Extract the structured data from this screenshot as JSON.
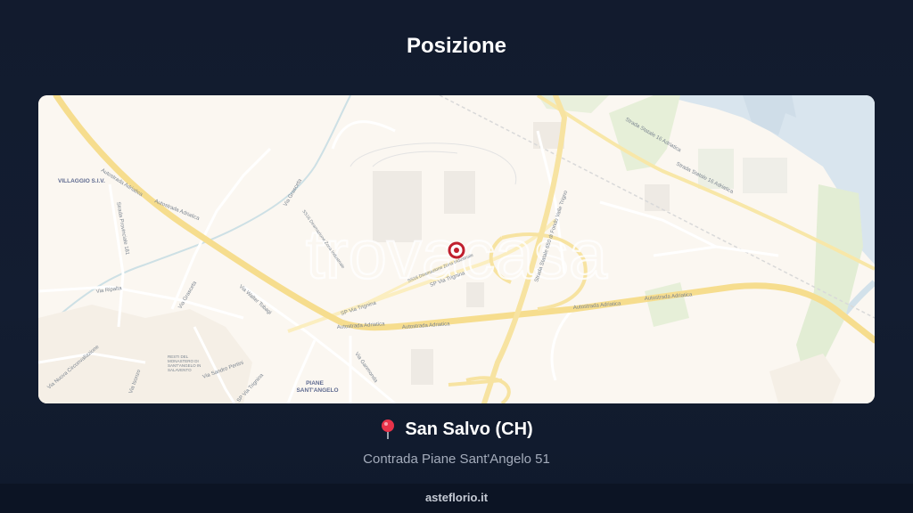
{
  "title": "Posizione",
  "map": {
    "watermark": "trovacasa",
    "place_labels": {
      "villaggio": "VILLAGGIO S.I.V.",
      "piane": "PIANE",
      "santangelo": "SANT'ANGELO",
      "resti_1": "RESTI DEL",
      "resti_2": "MONASTERO DI",
      "resti_3": "SANT'ANGELO IN",
      "resti_4": "SALAVENTO"
    },
    "road_labels": {
      "autostrada_1": "Autostrada Adriatica",
      "autostrada_2": "Autostrada Adriatica",
      "autostrada_3": "Autostrada Adriatica",
      "autostrada_4": "Autostrada Adriatica",
      "autostrada_5": "Autostrada Adriatica",
      "autostrada_6": "Autostrada Adriatica",
      "statale16_1": "Strada Statale 16 Adriatica",
      "statale16_2": "Strada Statale 16 Adriatica",
      "statale650": "Strada Statale 650 di Fondo Valle Trigno",
      "sp_trignina_1": "SP Via Trignina",
      "sp_trignina_2": "SP Via Trignina",
      "sp_trignina_3": "SP Via Trignina",
      "provinciale": "Strada Provinciale 181",
      "via_ripalta": "Via Ripalta",
      "via_grasceta_1": "Via Grasceta",
      "via_grasceta_2": "Via Grasceta",
      "via_walter": "Via Walter Tobagi",
      "via_sandro": "Via Sandro Pertini",
      "via_ganmonda": "Via Ganmonda",
      "via_isonzo": "Via Isonzo",
      "via_circonvallazione": "Via Nuova Circonvallazione",
      "circ_1": "SS16 Diramazione Zona Industriale",
      "circ_2": "SS16 Diramazione Zona Industriale"
    }
  },
  "location": {
    "city": "San Salvo (CH)",
    "address": "Contrada Piane Sant'Angelo 51",
    "pin_icon": "round-pushpin-icon"
  },
  "footer": {
    "brand": "asteflorio.it"
  },
  "colors": {
    "background": "#121c2f",
    "pin": "#c0202e",
    "highway": "#f6dd8e",
    "water": "#d9e5ee"
  }
}
